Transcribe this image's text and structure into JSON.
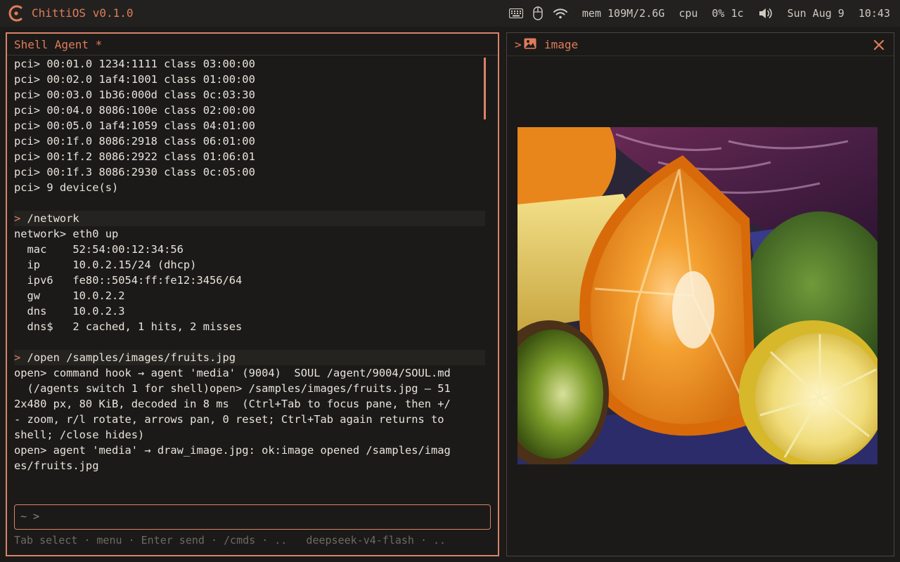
{
  "topbar": {
    "title": "ChittiOS v0.1.0",
    "mem": "mem 109M/2.6G",
    "cpu_label": "cpu",
    "cpu_value": "0% 1c",
    "date": "Sun Aug 9",
    "time": "10:43",
    "icons": [
      "logo-icon",
      "keyboard-icon",
      "mouse-icon",
      "wifi-icon",
      "volume-icon"
    ],
    "accent_color": "#e07c5a"
  },
  "shell": {
    "title": "Shell Agent *",
    "lines": [
      {
        "prompt": "",
        "text": "pci> 00:01.0 1234:1111 class 03:00:00"
      },
      {
        "prompt": "",
        "text": "pci> 00:02.0 1af4:1001 class 01:00:00"
      },
      {
        "prompt": "",
        "text": "pci> 00:03.0 1b36:000d class 0c:03:30"
      },
      {
        "prompt": "",
        "text": "pci> 00:04.0 8086:100e class 02:00:00"
      },
      {
        "prompt": "",
        "text": "pci> 00:05.0 1af4:1059 class 04:01:00"
      },
      {
        "prompt": "",
        "text": "pci> 00:1f.0 8086:2918 class 06:01:00"
      },
      {
        "prompt": "",
        "text": "pci> 00:1f.2 8086:2922 class 01:06:01"
      },
      {
        "prompt": "",
        "text": "pci> 00:1f.3 8086:2930 class 0c:05:00"
      },
      {
        "prompt": "",
        "text": "pci> 9 device(s)"
      },
      {
        "prompt": "",
        "text": ""
      },
      {
        "prompt": ">",
        "text": " /network"
      },
      {
        "prompt": "",
        "text": "network> eth0 up"
      },
      {
        "prompt": "",
        "text": "  mac    52:54:00:12:34:56"
      },
      {
        "prompt": "",
        "text": "  ip     10.0.2.15/24 (dhcp)"
      },
      {
        "prompt": "",
        "text": "  ipv6   fe80::5054:ff:fe12:3456/64"
      },
      {
        "prompt": "",
        "text": "  gw     10.0.2.2"
      },
      {
        "prompt": "",
        "text": "  dns    10.0.2.3"
      },
      {
        "prompt": "",
        "text": "  dns$   2 cached, 1 hits, 2 misses"
      },
      {
        "prompt": "",
        "text": ""
      },
      {
        "prompt": ">",
        "text": " /open /samples/images/fruits.jpg"
      },
      {
        "prompt": "",
        "text": "open> command hook → agent 'media' (9004)  SOUL /agent/9004/SOUL.md"
      },
      {
        "prompt": "",
        "text": "  (/agents switch 1 for shell)open> /samples/images/fruits.jpg — 51"
      },
      {
        "prompt": "",
        "text": "2x480 px, 80 KiB, decoded in 8 ms  (Ctrl+Tab to focus pane, then +/"
      },
      {
        "prompt": "",
        "text": "- zoom, r/l rotate, arrows pan, 0 reset; Ctrl+Tab again returns to"
      },
      {
        "prompt": "",
        "text": "shell; /close hides)"
      },
      {
        "prompt": "",
        "text": "open> agent 'media' → draw_image.jpg: ok:image opened /samples/imag"
      },
      {
        "prompt": "",
        "text": "es/fruits.jpg"
      }
    ],
    "input_prompt": "~ >",
    "input_value": "",
    "hint": "Tab select · menu · Enter send · /cmds · ..   deepseek-v4-flash · .."
  },
  "image_pane": {
    "caret": ">",
    "title": "image",
    "icon": "image-icon",
    "close_icon": "close-icon"
  }
}
